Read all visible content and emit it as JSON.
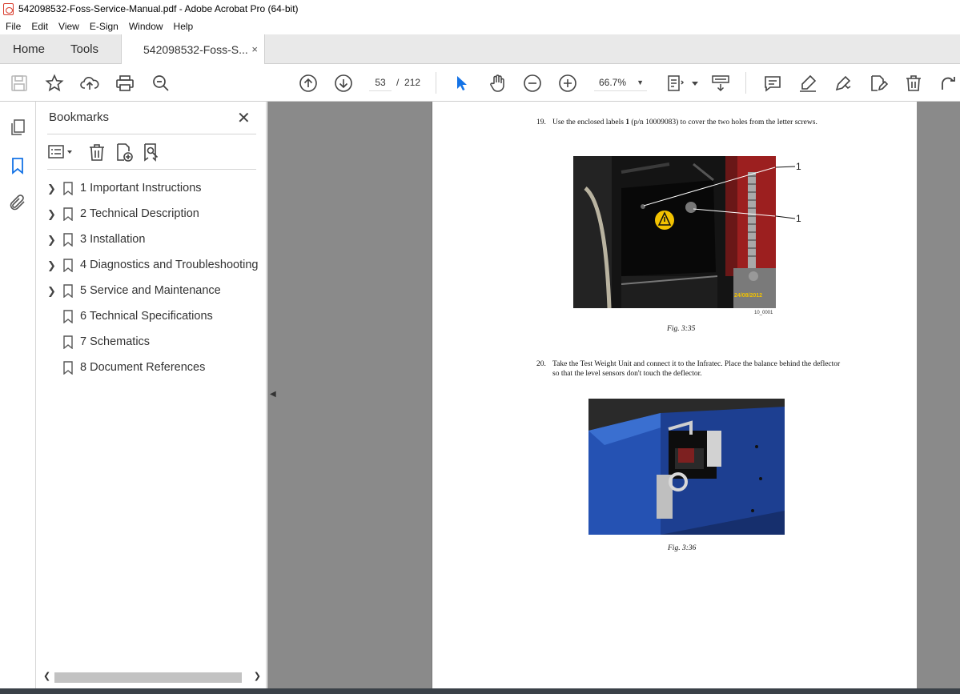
{
  "window": {
    "title": "542098532-Foss-Service-Manual.pdf - Adobe Acrobat Pro (64-bit)"
  },
  "menu": [
    "File",
    "Edit",
    "View",
    "E-Sign",
    "Window",
    "Help"
  ],
  "tabs": {
    "home": "Home",
    "tools": "Tools",
    "doc": "542098532-Foss-S...",
    "close": "×"
  },
  "toolbar": {
    "page_current": "53",
    "page_separator": "/",
    "page_total": "212",
    "zoom": "66.7%"
  },
  "bookmarks": {
    "title": "Bookmarks",
    "close": "✕",
    "items": [
      {
        "label": "1 Important Instructions",
        "expandable": true
      },
      {
        "label": "2 Technical Description",
        "expandable": true
      },
      {
        "label": "3 Installation",
        "expandable": true
      },
      {
        "label": "4 Diagnostics and Troubleshooting",
        "expandable": true
      },
      {
        "label": "5 Service and Maintenance",
        "expandable": true
      },
      {
        "label": "6 Technical Specifications",
        "expandable": false
      },
      {
        "label": "7 Schematics",
        "expandable": false
      },
      {
        "label": "8 Document References",
        "expandable": false
      }
    ]
  },
  "page": {
    "step19": {
      "num": "19.",
      "text_a": "Use the enclosed labels ",
      "text_bold": "1",
      "text_b": " (p/n 10009083) to cover the two holes from the letter screws."
    },
    "fig1": {
      "callout1": "1",
      "callout2": "1",
      "date_stamp": "24/08/2012",
      "id": "10_0001",
      "caption": "Fig. 3:35"
    },
    "step20": {
      "num": "20.",
      "text": "Take the Test Weight Unit and connect it to the Infratec. Place the balance behind the deflector so that the level sensors don't touch the deflector."
    },
    "fig2": {
      "caption": "Fig. 3:36"
    }
  },
  "colors": {
    "accent_blue": "#1473e6",
    "warning_yellow": "#f2c200",
    "viewer_gray": "#8a8a8a"
  }
}
